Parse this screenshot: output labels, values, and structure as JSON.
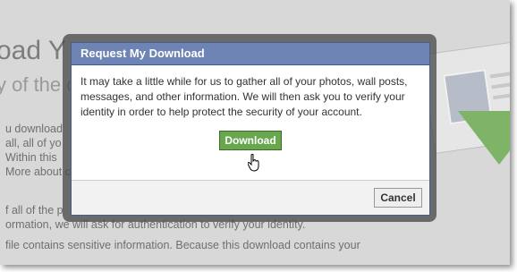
{
  "background": {
    "heading": "oad Y",
    "subheading": "y of the c",
    "lines": [
      "u download",
      "all, all of yo",
      "Within this",
      "More about c",
      "f all of the p",
      "ormation, we will ask for authentication to verify your identity.",
      "file contains sensitive information. Because this download contains your"
    ]
  },
  "dialog": {
    "title": "Request My Download",
    "message": "It may take a little while for us to gather all of your photos, wall posts, messages, and other information. We will then ask you to verify your identity in order to help protect the security of your account.",
    "download_label": "Download",
    "cancel_label": "Cancel"
  },
  "colors": {
    "header": "#6d84b4",
    "download_button": "#69a74e",
    "background_page": "#d8d8d8"
  }
}
